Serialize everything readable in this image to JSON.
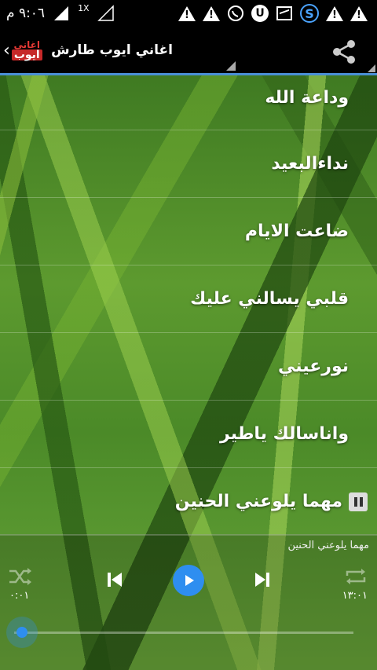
{
  "status_bar": {
    "time": "٩:٠٦ م",
    "signal_label": "1X"
  },
  "action_bar": {
    "title": "اغاني ايوب طارش",
    "logo_top": "اغاني",
    "logo_bottom": "ايوب"
  },
  "songs": [
    {
      "title": "وداعة الله"
    },
    {
      "title": "نداءالبعيد"
    },
    {
      "title": "ضاعت الايام"
    },
    {
      "title": "قلبي يسالني عليك"
    },
    {
      "title": "نورعيني"
    },
    {
      "title": "واناسالك ياطير"
    },
    {
      "title": "مهما يلوعني الحنين"
    }
  ],
  "player": {
    "now_playing": "مهما يلوعني الحنين",
    "elapsed": "٠:٠١",
    "total": "١٣:٠١",
    "progress": 0.0
  },
  "colors": {
    "accent": "#2e8ef0",
    "action_bar_border": "#4a8fd6"
  }
}
